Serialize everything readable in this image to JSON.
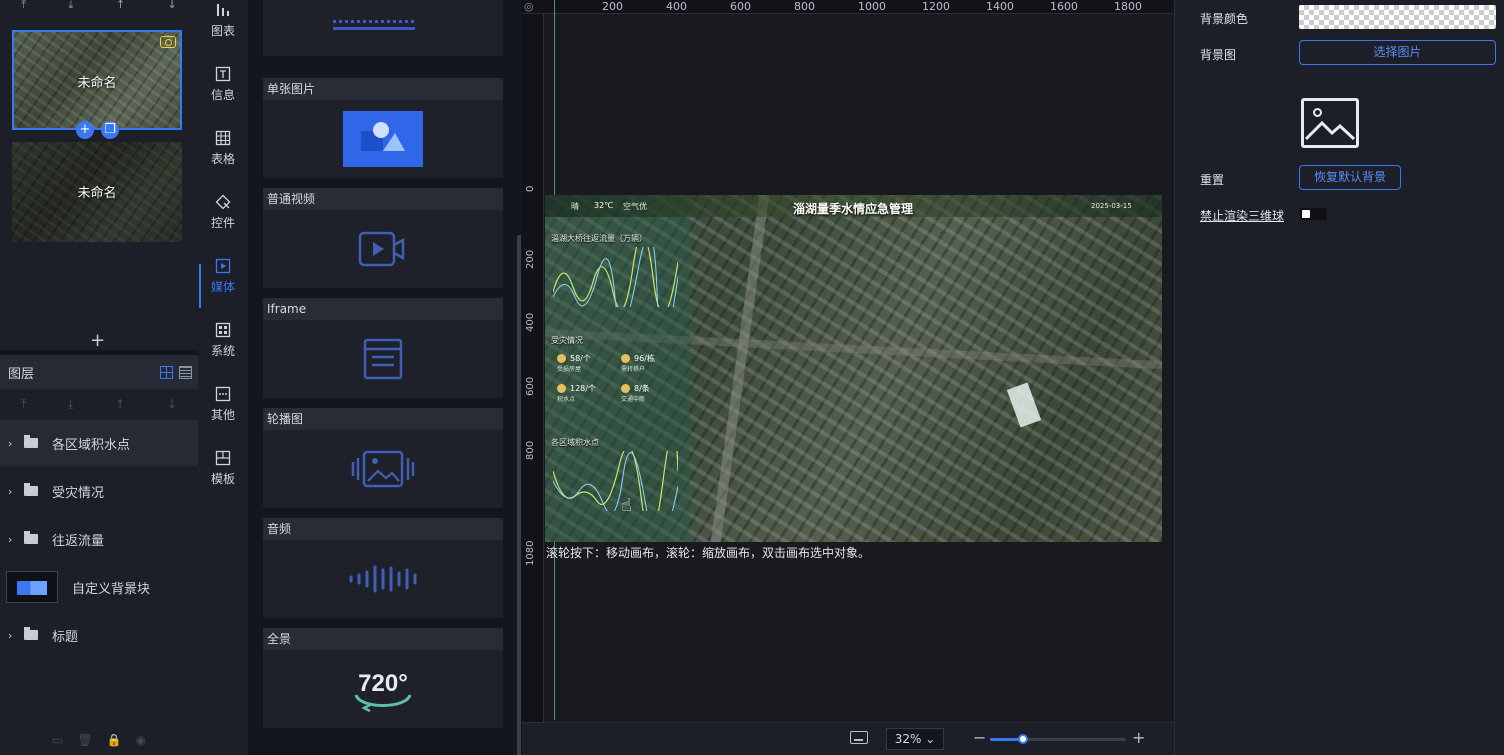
{
  "pages": {
    "tools": [
      "⤒",
      "⤓",
      "↑",
      "↓"
    ],
    "items": [
      {
        "name": "未命名",
        "selected": true
      },
      {
        "name": "未命名",
        "selected": false
      }
    ],
    "add_label": "+"
  },
  "layers": {
    "title": "图层",
    "tools": [
      "⤒",
      "⤓",
      "↑",
      "↓"
    ],
    "items": [
      {
        "label": "各区域积水点",
        "type": "folder",
        "active": true
      },
      {
        "label": "受灾情况",
        "type": "folder",
        "active": false
      },
      {
        "label": "往返流量",
        "type": "folder",
        "active": false
      },
      {
        "label": "自定义背景块",
        "type": "block",
        "active": false
      },
      {
        "label": "标题",
        "type": "folder",
        "active": false
      }
    ]
  },
  "categories": [
    {
      "label": "图表",
      "icon": "bar-chart-icon"
    },
    {
      "label": "信息",
      "icon": "text-icon"
    },
    {
      "label": "表格",
      "icon": "table-icon"
    },
    {
      "label": "控件",
      "icon": "widget-icon"
    },
    {
      "label": "媒体",
      "icon": "media-icon",
      "active": true
    },
    {
      "label": "系统",
      "icon": "system-icon"
    },
    {
      "label": "其他",
      "icon": "other-icon"
    },
    {
      "label": "模板",
      "icon": "template-icon"
    }
  ],
  "components": [
    {
      "label": "单张图片",
      "icon": "image-icon"
    },
    {
      "label": "普通视频",
      "icon": "video-icon"
    },
    {
      "label": "Iframe",
      "icon": "iframe-icon"
    },
    {
      "label": "轮播图",
      "icon": "carousel-icon"
    },
    {
      "label": "音频",
      "icon": "audio-icon"
    },
    {
      "label": "全景",
      "icon": "panorama-720-icon",
      "badge": "720°"
    }
  ],
  "canvas": {
    "h_ticks": [
      "200",
      "400",
      "600",
      "800",
      "1000",
      "1200",
      "1400",
      "1600",
      "1800"
    ],
    "v_ticks": [
      "0",
      "200",
      "400",
      "600",
      "800",
      "1080"
    ],
    "screen": {
      "title": "淄湖量季水情应急管理",
      "weather": "晴",
      "temp": "32℃",
      "air": "空气优",
      "date": "2025-03-15",
      "panel1_title": "淄湖大桥往返流量（万辆）",
      "panel2_title": "受灾情况",
      "panel3_title": "各区域积水点",
      "stats": [
        {
          "value": "58/个",
          "sub": "受损房屋"
        },
        {
          "value": "96/栋",
          "sub": "需转移户"
        },
        {
          "value": "128/个",
          "sub": "积水点"
        },
        {
          "value": "8/条",
          "sub": "交通中断"
        }
      ]
    },
    "hint": "滚轮按下：移动画布，滚轮：缩放画布，双击画布选中对象。",
    "zoom": "32%",
    "zoom_level": 0.24
  },
  "props": {
    "bg_color_label": "背景颜色",
    "bg_image_label": "背景图",
    "select_image_button": "选择图片",
    "reset_label": "重置",
    "restore_button": "恢复默认背景",
    "disable_globe_label": "禁止渲染三维球",
    "disable_globe": false
  },
  "colors": {
    "accent": "#3a78f2",
    "guide": "#53d39a"
  }
}
